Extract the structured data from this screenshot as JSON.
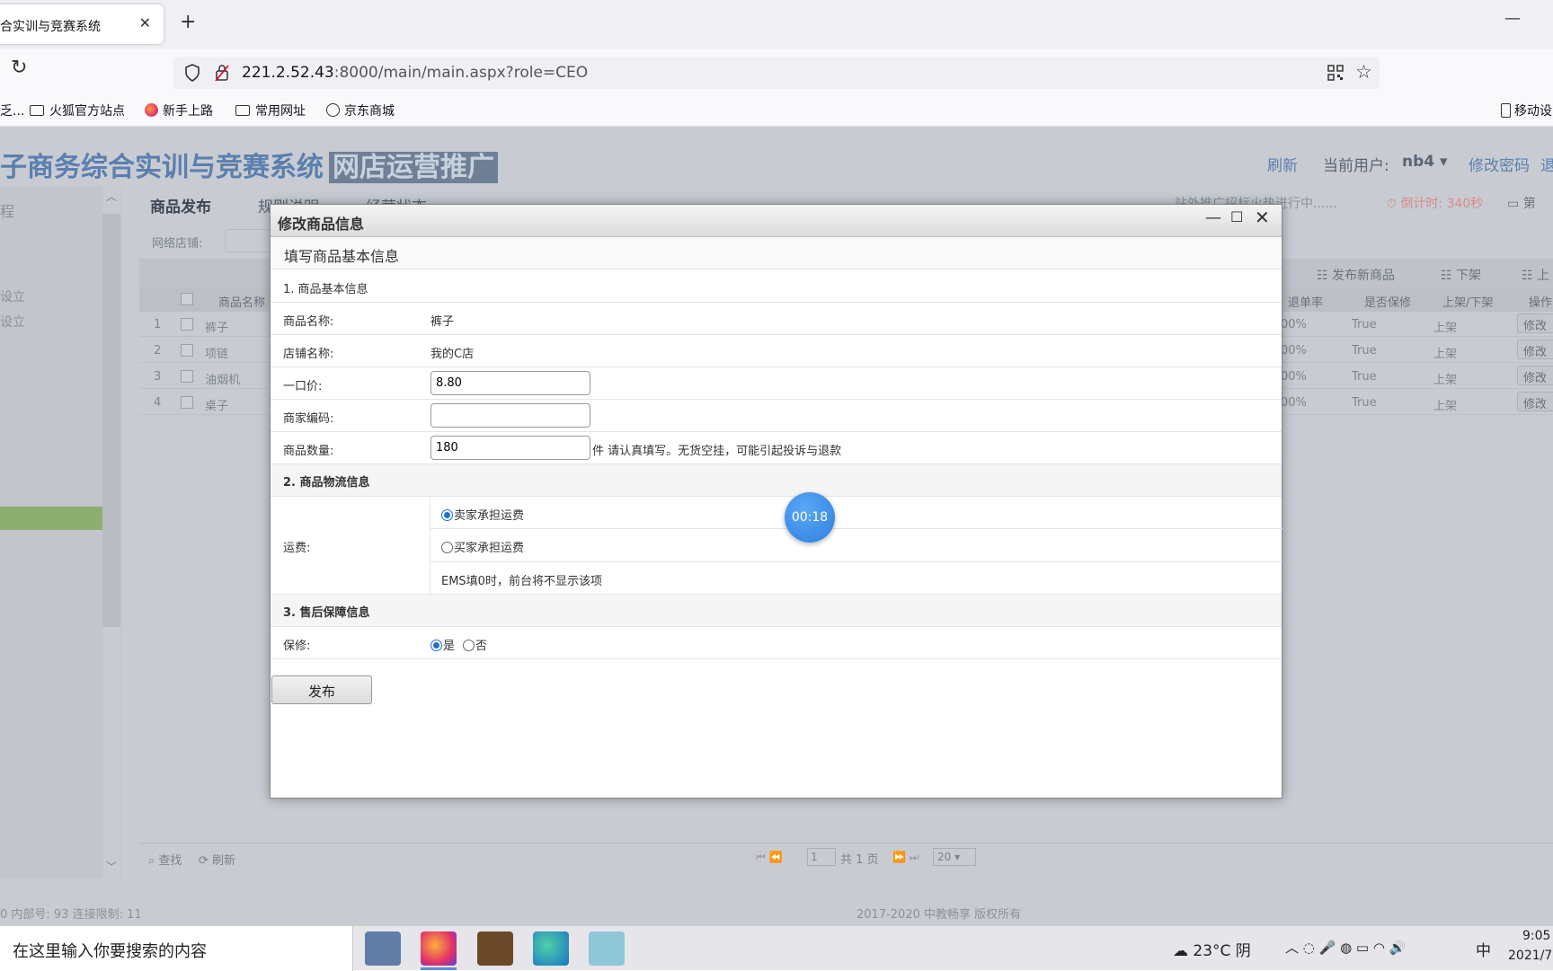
{
  "browser": {
    "tab_title": "合实训与竞赛系统",
    "url_host": "221.2.52.43",
    "url_rest": ":8000/main/main.aspx?role=CEO",
    "bookmarks": [
      "乏...",
      "火狐官方站点",
      "新手上路",
      "常用网址",
      "京东商城"
    ],
    "mobile_label": "移动设"
  },
  "app": {
    "title": "子商务综合实训与竞赛系统",
    "title_badge": "网店运营推广",
    "refresh": "刷新",
    "current_user_label": "当前用户:",
    "current_user": "nb4",
    "change_password": "修改密码",
    "logout": "退",
    "notice": "站外推广招标火热进行中......",
    "countdown": "倒计时: 340秒",
    "week": "第"
  },
  "sidebar": {
    "items": [
      "程",
      "设立",
      "设立"
    ]
  },
  "page_tabs": [
    "商品发布",
    "规则说明",
    "经营状态"
  ],
  "filter_label": "网络店铺:",
  "grid": {
    "toolbar": [
      "发布新商品",
      "下架",
      "上"
    ],
    "columns": [
      "商品名称",
      "退单率",
      "是否保修",
      "上架/下架",
      "操作"
    ],
    "rows": [
      {
        "no": "1",
        "name": "裤子",
        "rate": "00%",
        "warranty": "True",
        "status": "上架",
        "action": "修改"
      },
      {
        "no": "2",
        "name": "项链",
        "rate": "00%",
        "warranty": "True",
        "status": "上架",
        "action": "修改"
      },
      {
        "no": "3",
        "name": "油烟机",
        "rate": "00%",
        "warranty": "True",
        "status": "上架",
        "action": "修改"
      },
      {
        "no": "4",
        "name": "桌子",
        "rate": "00%",
        "warranty": "True",
        "status": "上架",
        "action": "修改"
      }
    ],
    "pager": {
      "find": "查找",
      "refresh": "刷新",
      "page": "1",
      "total": "共 1 页",
      "size": "20"
    }
  },
  "footer": {
    "left": "0 内部号: 93 连接限制: 11",
    "center": "2017-2020 中教畅享 版权所有"
  },
  "modal": {
    "title": "修改商品信息",
    "subtitle": "填写商品基本信息",
    "section1": "1. 商品基本信息",
    "product_name_label": "商品名称:",
    "product_name": "裤子",
    "shop_name_label": "店铺名称:",
    "shop_name": "我的C店",
    "price_label": "一口价:",
    "price": "8.80",
    "merchant_code_label": "商家编码:",
    "merchant_code": "",
    "quantity_label": "商品数量:",
    "quantity": "180",
    "quantity_hint": "件 请认真填写。无货空挂，可能引起投诉与退款",
    "section2": "2. 商品物流信息",
    "shipping_label": "运费:",
    "shipping_options": [
      "卖家承担运费",
      "买家承担运费"
    ],
    "shipping_selected": 0,
    "ems_note": "EMS填0时，前台将不显示该项",
    "section3": "3. 售后保障信息",
    "warranty_label": "保修:",
    "warranty_yes": "是",
    "warranty_no": "否",
    "publish": "发布"
  },
  "timer": "00:18",
  "taskbar": {
    "search_placeholder": "在这里输入你要搜索的内容",
    "weather": "23°C 阴",
    "ime": "中",
    "time": "9:05",
    "date": "2021/7"
  }
}
